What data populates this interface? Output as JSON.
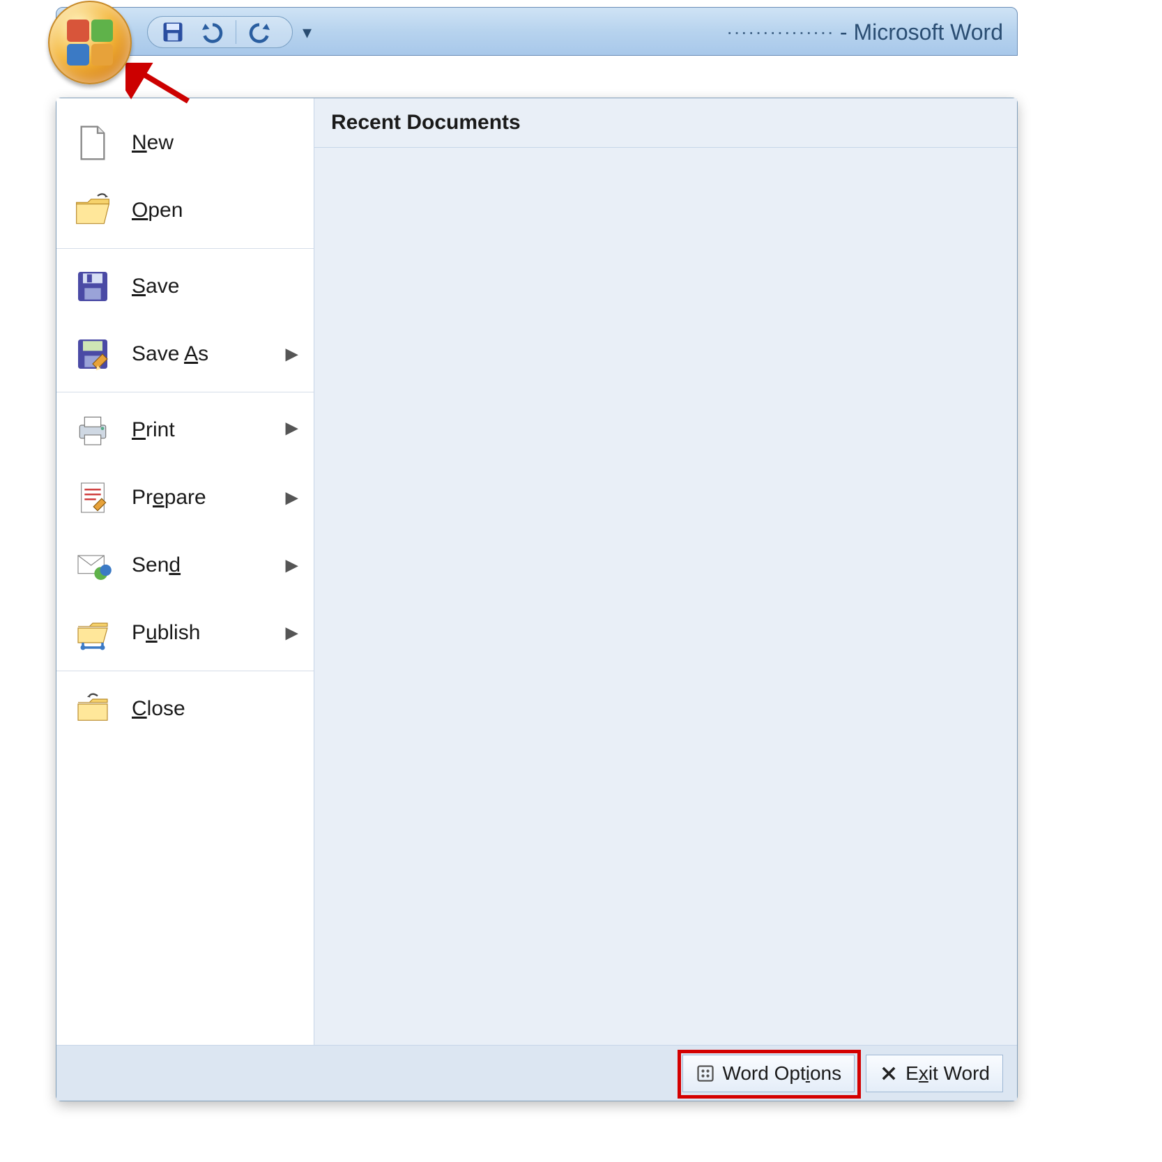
{
  "titlebar": {
    "doc_title_suffix": " - Microsoft Word",
    "doc_title_obscured": "···············"
  },
  "recent": {
    "header": "Recent Documents"
  },
  "menu": {
    "items": [
      {
        "key": "new",
        "pre": "",
        "ul": "N",
        "post": "ew",
        "arrow": false,
        "icon": "new"
      },
      {
        "key": "open",
        "pre": "",
        "ul": "O",
        "post": "pen",
        "arrow": false,
        "icon": "open"
      },
      {
        "key": "save",
        "pre": "",
        "ul": "S",
        "post": "ave",
        "arrow": false,
        "icon": "save"
      },
      {
        "key": "saveas",
        "pre": "Save ",
        "ul": "A",
        "post": "s",
        "arrow": true,
        "icon": "saveas"
      },
      {
        "key": "print",
        "pre": "",
        "ul": "P",
        "post": "rint",
        "arrow": true,
        "icon": "print"
      },
      {
        "key": "prepare",
        "pre": "Pr",
        "ul": "e",
        "post": "pare",
        "arrow": true,
        "icon": "prepare"
      },
      {
        "key": "send",
        "pre": "Sen",
        "ul": "d",
        "post": "",
        "arrow": true,
        "icon": "send"
      },
      {
        "key": "publish",
        "pre": "P",
        "ul": "u",
        "post": "blish",
        "arrow": true,
        "icon": "publish"
      },
      {
        "key": "close",
        "pre": "",
        "ul": "C",
        "post": "lose",
        "arrow": false,
        "icon": "close"
      }
    ]
  },
  "footer": {
    "word_options": {
      "pre": "Word Opt",
      "ul": "i",
      "post": "ons"
    },
    "exit_word": {
      "pre": "E",
      "ul": "x",
      "post": "it Word"
    }
  }
}
